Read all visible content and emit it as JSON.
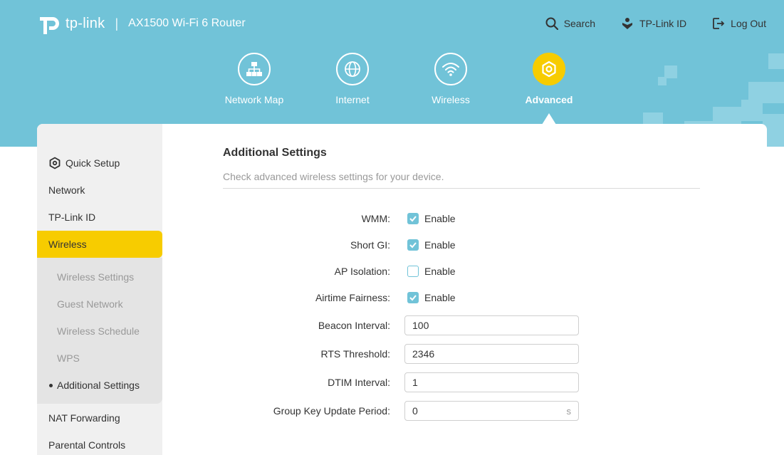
{
  "header": {
    "brand": "tp-link",
    "separator": "|",
    "product": "AX1500 Wi-Fi 6 Router",
    "actions": [
      {
        "label": "Search",
        "icon": "search-icon"
      },
      {
        "label": "TP-Link ID",
        "icon": "tplink-id-icon"
      },
      {
        "label": "Log Out",
        "icon": "logout-icon"
      }
    ]
  },
  "nav": {
    "items": [
      {
        "label": "Network Map",
        "icon": "network-map-icon"
      },
      {
        "label": "Internet",
        "icon": "globe-icon"
      },
      {
        "label": "Wireless",
        "icon": "wifi-icon"
      },
      {
        "label": "Advanced",
        "icon": "gear-icon",
        "active": true
      }
    ]
  },
  "sidebar": {
    "items": [
      {
        "label": "Quick Setup",
        "icon": "gear-icon"
      },
      {
        "label": "Network"
      },
      {
        "label": "TP-Link ID"
      },
      {
        "label": "Wireless",
        "active": true
      },
      {
        "label": "NAT Forwarding"
      },
      {
        "label": "Parental Controls"
      }
    ],
    "sub_items": [
      {
        "label": "Wireless Settings"
      },
      {
        "label": "Guest Network"
      },
      {
        "label": "Wireless Schedule"
      },
      {
        "label": "WPS"
      },
      {
        "label": "Additional Settings",
        "current": true
      }
    ]
  },
  "main": {
    "title": "Additional Settings",
    "description": "Check advanced wireless settings for your device.",
    "checkbox_text": "Enable",
    "fields": {
      "wmm": {
        "label": "WMM:",
        "checked": true
      },
      "short_gi": {
        "label": "Short GI:",
        "checked": true
      },
      "ap_isolation": {
        "label": "AP Isolation:",
        "checked": false
      },
      "airtime_fairness": {
        "label": "Airtime Fairness:",
        "checked": true
      },
      "beacon_interval": {
        "label": "Beacon Interval:",
        "value": "100"
      },
      "rts_threshold": {
        "label": "RTS Threshold:",
        "value": "2346"
      },
      "dtim_interval": {
        "label": "DTIM Interval:",
        "value": "1"
      },
      "group_key": {
        "label": "Group Key Update Period:",
        "value": "0",
        "unit": "s"
      }
    }
  },
  "colors": {
    "header_bg": "#71c3d8",
    "accent": "#f7cc00",
    "checkbox": "#71c3d8"
  }
}
